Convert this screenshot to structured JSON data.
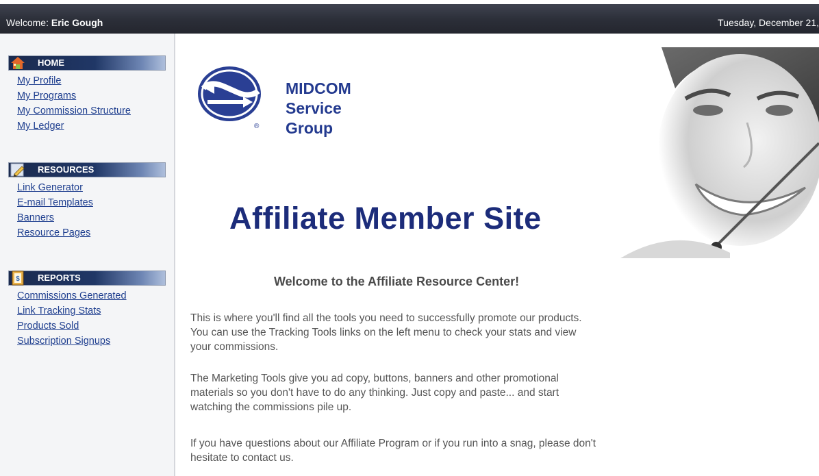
{
  "topbar": {
    "welcome_label": "Welcome: ",
    "user_name": "Eric Gough",
    "date": "Tuesday, December 21,"
  },
  "sidebar": {
    "home": {
      "title": "HOME",
      "icon": "home-icon",
      "items": [
        "My Profile",
        "My Programs",
        "My Commission Structure",
        "My Ledger"
      ]
    },
    "resources": {
      "title": "RESOURCES",
      "icon": "pencil-icon",
      "items": [
        "Link Generator",
        "E-mail Templates",
        "Banners",
        "Resource Pages"
      ]
    },
    "reports": {
      "title": "REPORTS",
      "icon": "report-icon",
      "items": [
        "Commissions Generated",
        "Link Tracking Stats",
        "Products Sold",
        "Subscription Signups"
      ]
    }
  },
  "logo": {
    "line1": "MIDCOM",
    "line2": "Service",
    "line3": "Group",
    "registered": "®"
  },
  "main": {
    "headline": "Affiliate Member Site",
    "welcome_title": "Welcome to the Affiliate Resource Center!",
    "paragraph1_line1": "This is where you'll find all the tools you need to successfully promote our products.",
    "paragraph1_line2": "You can use the Tracking Tools links on the left menu to check your stats and view",
    "paragraph1_line3": "your commissions.",
    "paragraph2_line1": "The Marketing Tools give you ad copy, buttons, banners and other promotional",
    "paragraph2_line2": "materials so you don't have to do any thinking. Just copy and paste... and start",
    "paragraph2_line3": "watching the commissions pile up.",
    "paragraph3_line1": "If you have questions about our Affiliate Program or if you run into a snag, please don't",
    "paragraph3_line2": "hesitate to contact us."
  },
  "colors": {
    "topbar": "#2b2e38",
    "link": "#1f3f8f",
    "headline": "#1c2c7a",
    "logo_blue": "#233a8f"
  }
}
